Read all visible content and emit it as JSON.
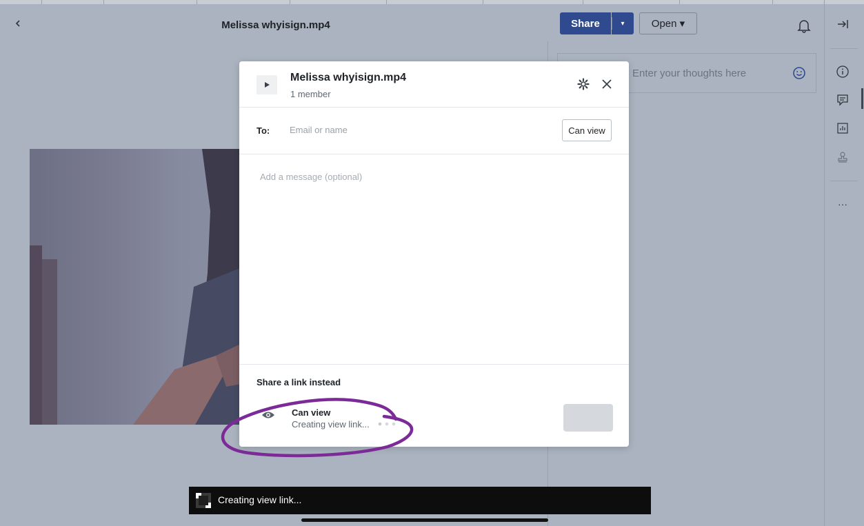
{
  "header": {
    "title": "Melissa whyisign.mp4",
    "share_label": "Share",
    "share_caret": "▾",
    "open_label": "Open ▾"
  },
  "comments": {
    "placeholder": "Enter your thoughts here"
  },
  "rail": {
    "icons": [
      "info-icon",
      "comment-icon",
      "stats-icon",
      "stamp-icon",
      "more-icon"
    ],
    "more_label": "···"
  },
  "modal": {
    "title": "Melissa whyisign.mp4",
    "subtitle": "1 member",
    "to_label": "To:",
    "to_placeholder": "Email or name",
    "permission_label": "Can view",
    "message_placeholder": "Add a message (optional)",
    "link_heading": "Share a link instead",
    "link_permission": "Can view",
    "link_status": "Creating view link..."
  },
  "toast": {
    "text": "Creating view link..."
  },
  "colors": {
    "primary": "#2f4a8f",
    "backdrop": "#aab3bf",
    "annotation": "#7b2a97"
  }
}
